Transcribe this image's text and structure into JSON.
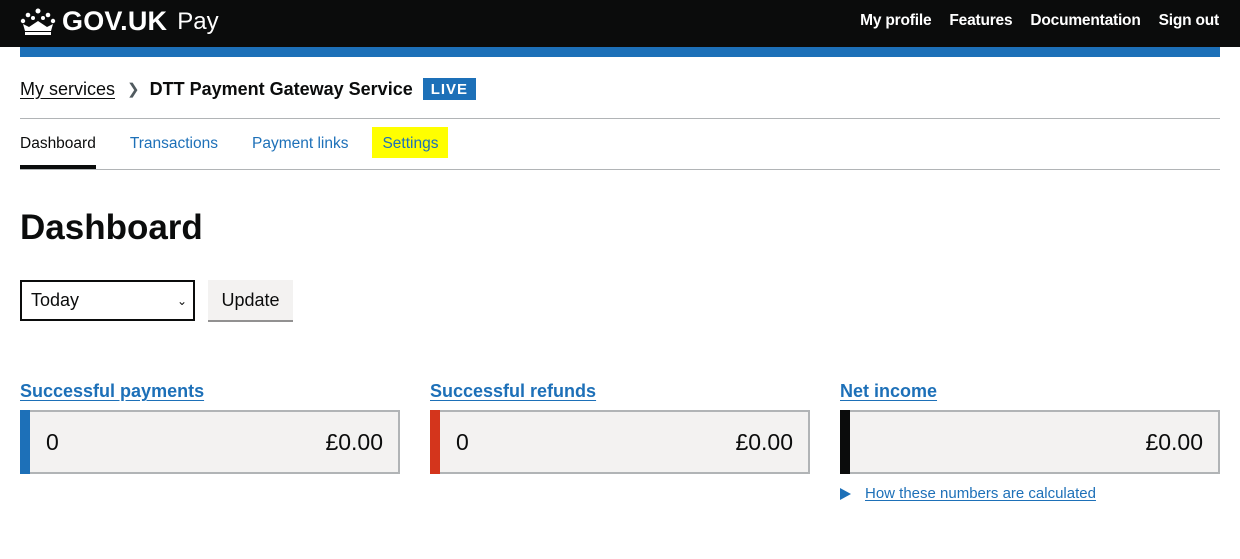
{
  "header": {
    "logo_text": "GOV.UK",
    "product_name": "Pay",
    "nav": [
      "My profile",
      "Features",
      "Documentation",
      "Sign out"
    ]
  },
  "breadcrumb": {
    "my_services": "My services",
    "service_name": "DTT Payment Gateway Service",
    "status_tag": "LIVE"
  },
  "tabs": [
    "Dashboard",
    "Transactions",
    "Payment links",
    "Settings"
  ],
  "page": {
    "title": "Dashboard",
    "period_select": "Today",
    "update_button": "Update"
  },
  "stats": [
    {
      "title": "Successful payments",
      "count": "0",
      "amount": "£0.00",
      "stripe_color": "#1d70b8"
    },
    {
      "title": "Successful refunds",
      "count": "0",
      "amount": "£0.00",
      "stripe_color": "#d4351c"
    },
    {
      "title": "Net income",
      "count": "",
      "amount": "£0.00",
      "stripe_color": "#0b0c0c"
    }
  ],
  "calc_link": "How these numbers are calculated",
  "colors": {
    "header_bg": "#0b0c0c",
    "brand_blue": "#1d70b8",
    "highlight": "#ffff00"
  }
}
